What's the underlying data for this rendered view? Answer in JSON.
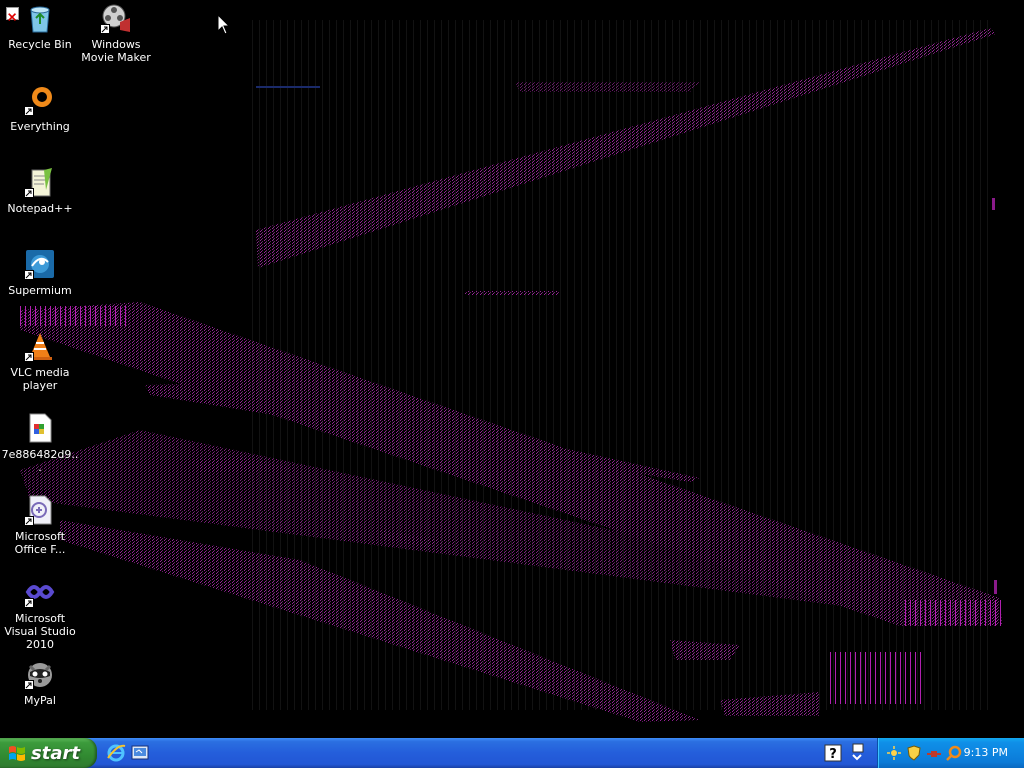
{
  "desktop": {
    "icons": [
      {
        "label": "Recycle Bin",
        "icon": "recycle-bin-icon"
      },
      {
        "label": "Windows Movie Maker",
        "icon": "movie-maker-icon"
      },
      {
        "label": "Everything",
        "icon": "everything-search-icon"
      },
      {
        "label": "Notepad++",
        "icon": "notepad-plus-plus-icon"
      },
      {
        "label": "Supermium",
        "icon": "supermium-browser-icon"
      },
      {
        "label": "VLC media player",
        "icon": "vlc-cone-icon"
      },
      {
        "label": "7e886482d9...",
        "icon": "image-file-icon"
      },
      {
        "label": "Microsoft Office F...",
        "icon": "office-file-icon"
      },
      {
        "label": "Microsoft Visual Studio 2010",
        "icon": "visual-studio-icon"
      },
      {
        "label": "MyPal",
        "icon": "mypal-raccoon-icon"
      }
    ]
  },
  "taskbar": {
    "start_label": "start",
    "clock": "9:13 PM"
  },
  "colors": {
    "desktop_bg": "#000000",
    "artifact": "#8a1a8a",
    "taskbar_blue": "#245edb",
    "start_green": "#3c9b3c",
    "tray_blue": "#0f8fe8"
  }
}
